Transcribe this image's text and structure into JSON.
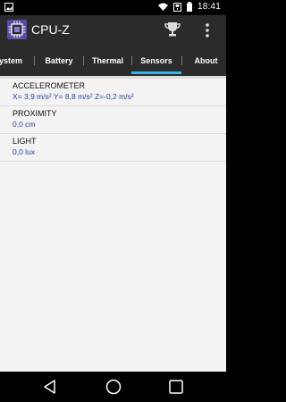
{
  "status_bar": {
    "time": "18:41",
    "icons": [
      "image-notification-icon",
      "wifi-icon",
      "trophy-small-icon",
      "battery-icon"
    ]
  },
  "app": {
    "title": "CPU-Z"
  },
  "tabs": [
    {
      "label": "System"
    },
    {
      "label": "Battery"
    },
    {
      "label": "Thermal"
    },
    {
      "label": "Sensors",
      "active": true
    },
    {
      "label": "About"
    }
  ],
  "sensors": [
    {
      "name": "ACCELEROMETER",
      "value": "X= 3,9 m/s²   Y= 8,8 m/s²   Z=-0,2 m/s²"
    },
    {
      "name": "PROXIMITY",
      "value": "0,0 cm"
    },
    {
      "name": "LIGHT",
      "value": "0,0 lux"
    }
  ],
  "colors": {
    "accent": "#33b5e5",
    "toolbar": "#2b2b2b",
    "value_text": "#2a3fa0"
  },
  "nav_icons": [
    "back-icon",
    "home-icon",
    "recents-icon"
  ]
}
